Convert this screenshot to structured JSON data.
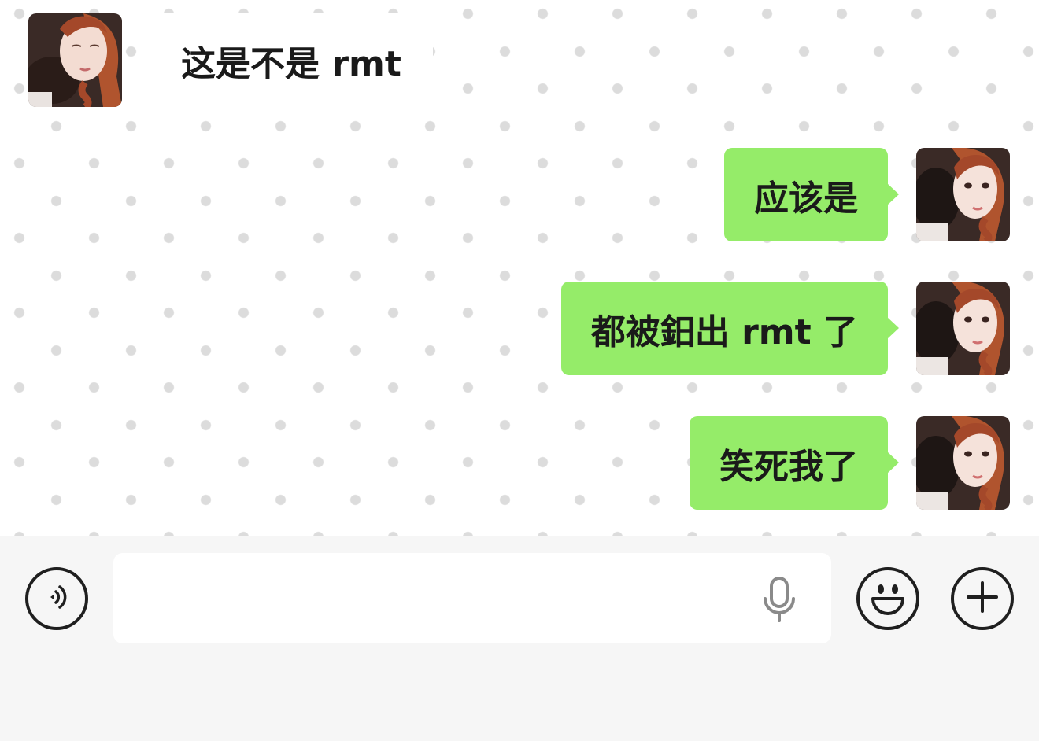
{
  "chat": {
    "messages": [
      {
        "direction": "in",
        "text": "这是不是 rmt"
      },
      {
        "direction": "out",
        "text": "应该是"
      },
      {
        "direction": "out",
        "text": "都被鈤出 rmt 了"
      },
      {
        "direction": "out",
        "text": "笑死我了"
      }
    ]
  },
  "input_bar": {
    "placeholder": "",
    "icons": {
      "voice": "voice-mode-icon",
      "mic": "microphone-icon",
      "emoji": "emoji-icon",
      "more": "plus-icon"
    }
  },
  "colors": {
    "outgoing_bubble": "#95ec69",
    "incoming_bubble": "#ffffff",
    "chat_background": "#ffffff",
    "input_bar_background": "#f6f6f6"
  }
}
